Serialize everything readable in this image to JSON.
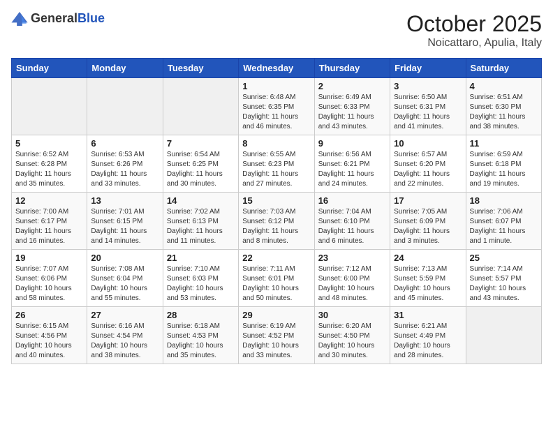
{
  "logo": {
    "general": "General",
    "blue": "Blue"
  },
  "header": {
    "month": "October 2025",
    "location": "Noicattaro, Apulia, Italy"
  },
  "weekdays": [
    "Sunday",
    "Monday",
    "Tuesday",
    "Wednesday",
    "Thursday",
    "Friday",
    "Saturday"
  ],
  "weeks": [
    [
      {
        "day": "",
        "sunrise": "",
        "sunset": "",
        "daylight": ""
      },
      {
        "day": "",
        "sunrise": "",
        "sunset": "",
        "daylight": ""
      },
      {
        "day": "",
        "sunrise": "",
        "sunset": "",
        "daylight": ""
      },
      {
        "day": "1",
        "sunrise": "Sunrise: 6:48 AM",
        "sunset": "Sunset: 6:35 PM",
        "daylight": "Daylight: 11 hours and 46 minutes."
      },
      {
        "day": "2",
        "sunrise": "Sunrise: 6:49 AM",
        "sunset": "Sunset: 6:33 PM",
        "daylight": "Daylight: 11 hours and 43 minutes."
      },
      {
        "day": "3",
        "sunrise": "Sunrise: 6:50 AM",
        "sunset": "Sunset: 6:31 PM",
        "daylight": "Daylight: 11 hours and 41 minutes."
      },
      {
        "day": "4",
        "sunrise": "Sunrise: 6:51 AM",
        "sunset": "Sunset: 6:30 PM",
        "daylight": "Daylight: 11 hours and 38 minutes."
      }
    ],
    [
      {
        "day": "5",
        "sunrise": "Sunrise: 6:52 AM",
        "sunset": "Sunset: 6:28 PM",
        "daylight": "Daylight: 11 hours and 35 minutes."
      },
      {
        "day": "6",
        "sunrise": "Sunrise: 6:53 AM",
        "sunset": "Sunset: 6:26 PM",
        "daylight": "Daylight: 11 hours and 33 minutes."
      },
      {
        "day": "7",
        "sunrise": "Sunrise: 6:54 AM",
        "sunset": "Sunset: 6:25 PM",
        "daylight": "Daylight: 11 hours and 30 minutes."
      },
      {
        "day": "8",
        "sunrise": "Sunrise: 6:55 AM",
        "sunset": "Sunset: 6:23 PM",
        "daylight": "Daylight: 11 hours and 27 minutes."
      },
      {
        "day": "9",
        "sunrise": "Sunrise: 6:56 AM",
        "sunset": "Sunset: 6:21 PM",
        "daylight": "Daylight: 11 hours and 24 minutes."
      },
      {
        "day": "10",
        "sunrise": "Sunrise: 6:57 AM",
        "sunset": "Sunset: 6:20 PM",
        "daylight": "Daylight: 11 hours and 22 minutes."
      },
      {
        "day": "11",
        "sunrise": "Sunrise: 6:59 AM",
        "sunset": "Sunset: 6:18 PM",
        "daylight": "Daylight: 11 hours and 19 minutes."
      }
    ],
    [
      {
        "day": "12",
        "sunrise": "Sunrise: 7:00 AM",
        "sunset": "Sunset: 6:17 PM",
        "daylight": "Daylight: 11 hours and 16 minutes."
      },
      {
        "day": "13",
        "sunrise": "Sunrise: 7:01 AM",
        "sunset": "Sunset: 6:15 PM",
        "daylight": "Daylight: 11 hours and 14 minutes."
      },
      {
        "day": "14",
        "sunrise": "Sunrise: 7:02 AM",
        "sunset": "Sunset: 6:13 PM",
        "daylight": "Daylight: 11 hours and 11 minutes."
      },
      {
        "day": "15",
        "sunrise": "Sunrise: 7:03 AM",
        "sunset": "Sunset: 6:12 PM",
        "daylight": "Daylight: 11 hours and 8 minutes."
      },
      {
        "day": "16",
        "sunrise": "Sunrise: 7:04 AM",
        "sunset": "Sunset: 6:10 PM",
        "daylight": "Daylight: 11 hours and 6 minutes."
      },
      {
        "day": "17",
        "sunrise": "Sunrise: 7:05 AM",
        "sunset": "Sunset: 6:09 PM",
        "daylight": "Daylight: 11 hours and 3 minutes."
      },
      {
        "day": "18",
        "sunrise": "Sunrise: 7:06 AM",
        "sunset": "Sunset: 6:07 PM",
        "daylight": "Daylight: 11 hours and 1 minute."
      }
    ],
    [
      {
        "day": "19",
        "sunrise": "Sunrise: 7:07 AM",
        "sunset": "Sunset: 6:06 PM",
        "daylight": "Daylight: 10 hours and 58 minutes."
      },
      {
        "day": "20",
        "sunrise": "Sunrise: 7:08 AM",
        "sunset": "Sunset: 6:04 PM",
        "daylight": "Daylight: 10 hours and 55 minutes."
      },
      {
        "day": "21",
        "sunrise": "Sunrise: 7:10 AM",
        "sunset": "Sunset: 6:03 PM",
        "daylight": "Daylight: 10 hours and 53 minutes."
      },
      {
        "day": "22",
        "sunrise": "Sunrise: 7:11 AM",
        "sunset": "Sunset: 6:01 PM",
        "daylight": "Daylight: 10 hours and 50 minutes."
      },
      {
        "day": "23",
        "sunrise": "Sunrise: 7:12 AM",
        "sunset": "Sunset: 6:00 PM",
        "daylight": "Daylight: 10 hours and 48 minutes."
      },
      {
        "day": "24",
        "sunrise": "Sunrise: 7:13 AM",
        "sunset": "Sunset: 5:59 PM",
        "daylight": "Daylight: 10 hours and 45 minutes."
      },
      {
        "day": "25",
        "sunrise": "Sunrise: 7:14 AM",
        "sunset": "Sunset: 5:57 PM",
        "daylight": "Daylight: 10 hours and 43 minutes."
      }
    ],
    [
      {
        "day": "26",
        "sunrise": "Sunrise: 6:15 AM",
        "sunset": "Sunset: 4:56 PM",
        "daylight": "Daylight: 10 hours and 40 minutes."
      },
      {
        "day": "27",
        "sunrise": "Sunrise: 6:16 AM",
        "sunset": "Sunset: 4:54 PM",
        "daylight": "Daylight: 10 hours and 38 minutes."
      },
      {
        "day": "28",
        "sunrise": "Sunrise: 6:18 AM",
        "sunset": "Sunset: 4:53 PM",
        "daylight": "Daylight: 10 hours and 35 minutes."
      },
      {
        "day": "29",
        "sunrise": "Sunrise: 6:19 AM",
        "sunset": "Sunset: 4:52 PM",
        "daylight": "Daylight: 10 hours and 33 minutes."
      },
      {
        "day": "30",
        "sunrise": "Sunrise: 6:20 AM",
        "sunset": "Sunset: 4:50 PM",
        "daylight": "Daylight: 10 hours and 30 minutes."
      },
      {
        "day": "31",
        "sunrise": "Sunrise: 6:21 AM",
        "sunset": "Sunset: 4:49 PM",
        "daylight": "Daylight: 10 hours and 28 minutes."
      },
      {
        "day": "",
        "sunrise": "",
        "sunset": "",
        "daylight": ""
      }
    ]
  ]
}
